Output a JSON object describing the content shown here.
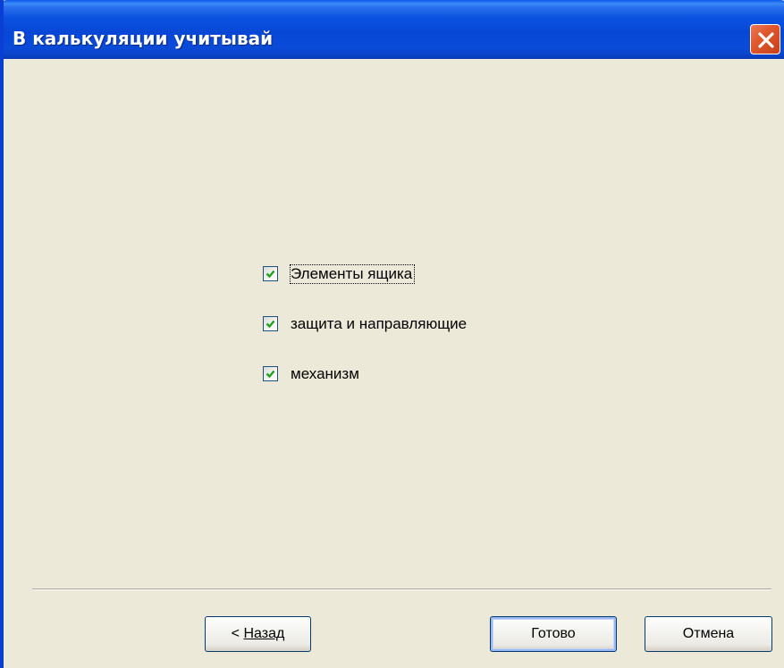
{
  "window": {
    "title": "В калькуляции учитывай"
  },
  "options": [
    {
      "label": "Элементы ящика",
      "checked": true,
      "focused": true
    },
    {
      "label": "защита и направляющие",
      "checked": true,
      "focused": false
    },
    {
      "label": "механизм",
      "checked": true,
      "focused": false
    }
  ],
  "buttons": {
    "back_prefix": "< ",
    "back_label": "Назад",
    "finish_label": "Готово",
    "cancel_label": "Отмена"
  },
  "colors": {
    "titlebar": "#0a52e0",
    "dialog_background": "#ece9d8",
    "close_button": "#e0582d",
    "checkmark": "#21a121"
  }
}
